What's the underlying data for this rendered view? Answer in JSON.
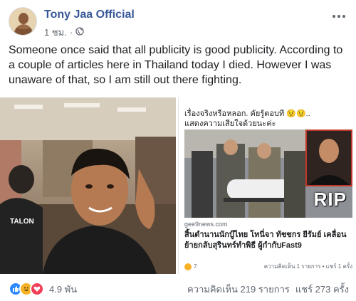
{
  "post": {
    "page_name": "Tony Jaa Official",
    "time": "1 ชม.",
    "separator": "·",
    "privacy_icon": "globe-icon",
    "more_icon": "ellipsis-icon",
    "text": "Someone once said that all publicity is good publicity. According to a couple of articles here in Thailand today I died. However I was unaware of that, so I am still out there fighting."
  },
  "left_photo": {
    "shirt_text": "TALON"
  },
  "shared_screenshot": {
    "line1": "เรื่องจริงหรือหลอก. คัยรู้ตอบที 😟😟..",
    "line2": "แสดงความเสียใจด้วยนะค่ะ",
    "rip_text": "RIP",
    "domain": "gee9news.com",
    "headline": "สิ้นตำนานนักบู๊ไทย โทนี่จา ทัชชกร ยีรัมย์ เคลื่อนย้ายกลับสุรินทร์ทำพิธี ผู้กำกับFast9",
    "reaction_count": "7",
    "comment_share": "ความคิดเห็น 1 รายการ • แชร์ 1 ครั้ง"
  },
  "footer": {
    "reaction_icons": [
      "like-icon",
      "haha-icon",
      "love-icon"
    ],
    "reaction_count": "4.9 พัน",
    "comments": "ความคิดเห็น 219 รายการ",
    "shares": "แชร์ 273 ครั้ง"
  },
  "colors": {
    "page_name": "#385898",
    "meta": "#606770",
    "like": "#2d88ff",
    "haha": "#f7b125",
    "love": "#f33e58"
  }
}
